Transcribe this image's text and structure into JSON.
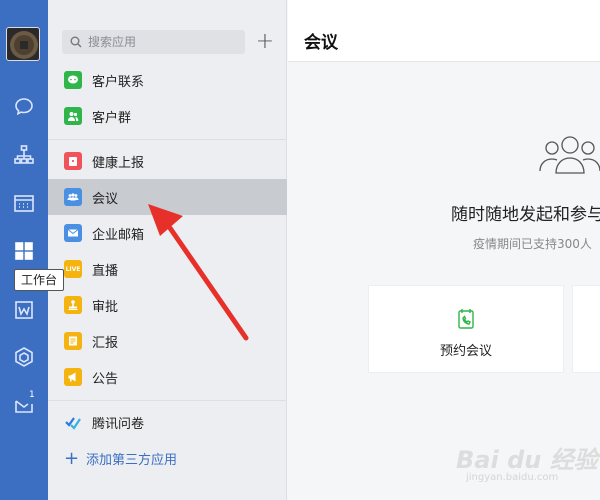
{
  "rail": {
    "tooltip": "工作台",
    "mail_badge": "1",
    "items": [
      {
        "icon": "chat-icon"
      },
      {
        "icon": "org-chart-icon"
      },
      {
        "icon": "calendar-icon"
      },
      {
        "icon": "workbench-grid-icon"
      },
      {
        "icon": "document-icon"
      },
      {
        "icon": "hexagon-icon"
      },
      {
        "icon": "mail-icon"
      }
    ]
  },
  "panel": {
    "search_placeholder": "搜索应用",
    "add_third_party": "添加第三方应用",
    "apps": [
      {
        "label": "客户联系",
        "color": "#2fb54a"
      },
      {
        "label": "客户群",
        "color": "#2fb54a"
      },
      {
        "label": "健康上报",
        "color": "#f0535a"
      },
      {
        "label": "会议",
        "color": "#4a90e2"
      },
      {
        "label": "企业邮箱",
        "color": "#4a90e2"
      },
      {
        "label": "直播",
        "color": "#f5b30f",
        "badge": "LIVE"
      },
      {
        "label": "审批",
        "color": "#f5b30f"
      },
      {
        "label": "汇报",
        "color": "#f5b30f"
      },
      {
        "label": "公告",
        "color": "#f5b30f"
      },
      {
        "label": "腾讯问卷",
        "color": "#2a7ae2"
      }
    ]
  },
  "content": {
    "title": "会议",
    "hero_title": "随时随地发起和参与",
    "hero_sub": "疫情期间已支持300人",
    "cards": [
      {
        "label": "预约会议",
        "icon": "phone-calendar-icon"
      }
    ]
  },
  "watermark": {
    "main": "Bai du 经验",
    "sub": "jingyan.baidu.com"
  },
  "colors": {
    "rail": "#3c6ec2",
    "active_row": "#c8cbd0",
    "arrow": "#e8302a",
    "link": "#3c6ec2"
  }
}
